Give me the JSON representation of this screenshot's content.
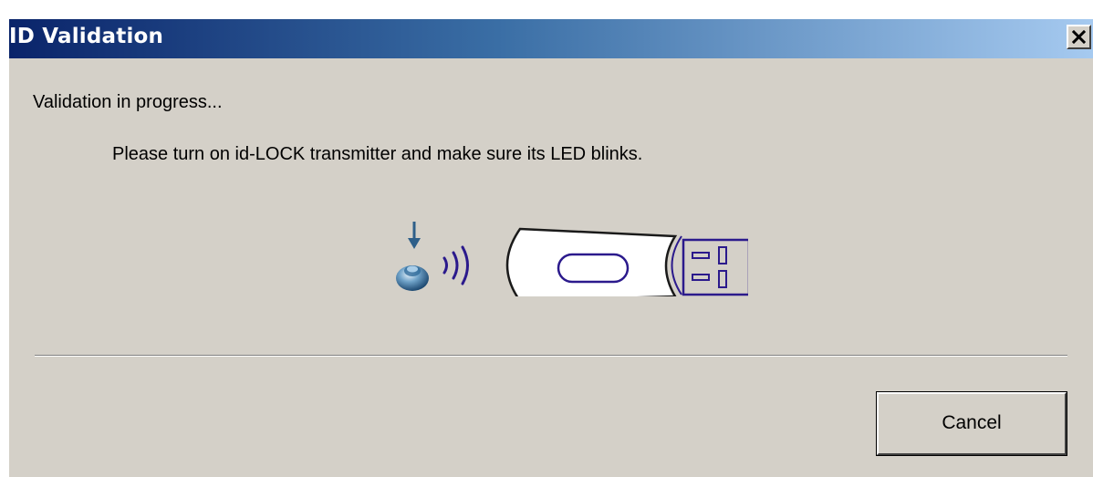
{
  "window": {
    "title": "ID Validation",
    "close_icon": "close-icon"
  },
  "content": {
    "status": "Validation in progress...",
    "instruction": "Please turn on id-LOCK transmitter and make sure its LED blinks.",
    "illustration_icons": [
      "power-button-icon",
      "wireless-signal-icon",
      "usb-key-icon"
    ]
  },
  "buttons": {
    "cancel_label": "Cancel"
  },
  "colors": {
    "titlebar_start": "#0a246a",
    "titlebar_end": "#a6caf0",
    "dialog_bg": "#d4d0c8",
    "signal_purple": "#2b1a8c"
  }
}
